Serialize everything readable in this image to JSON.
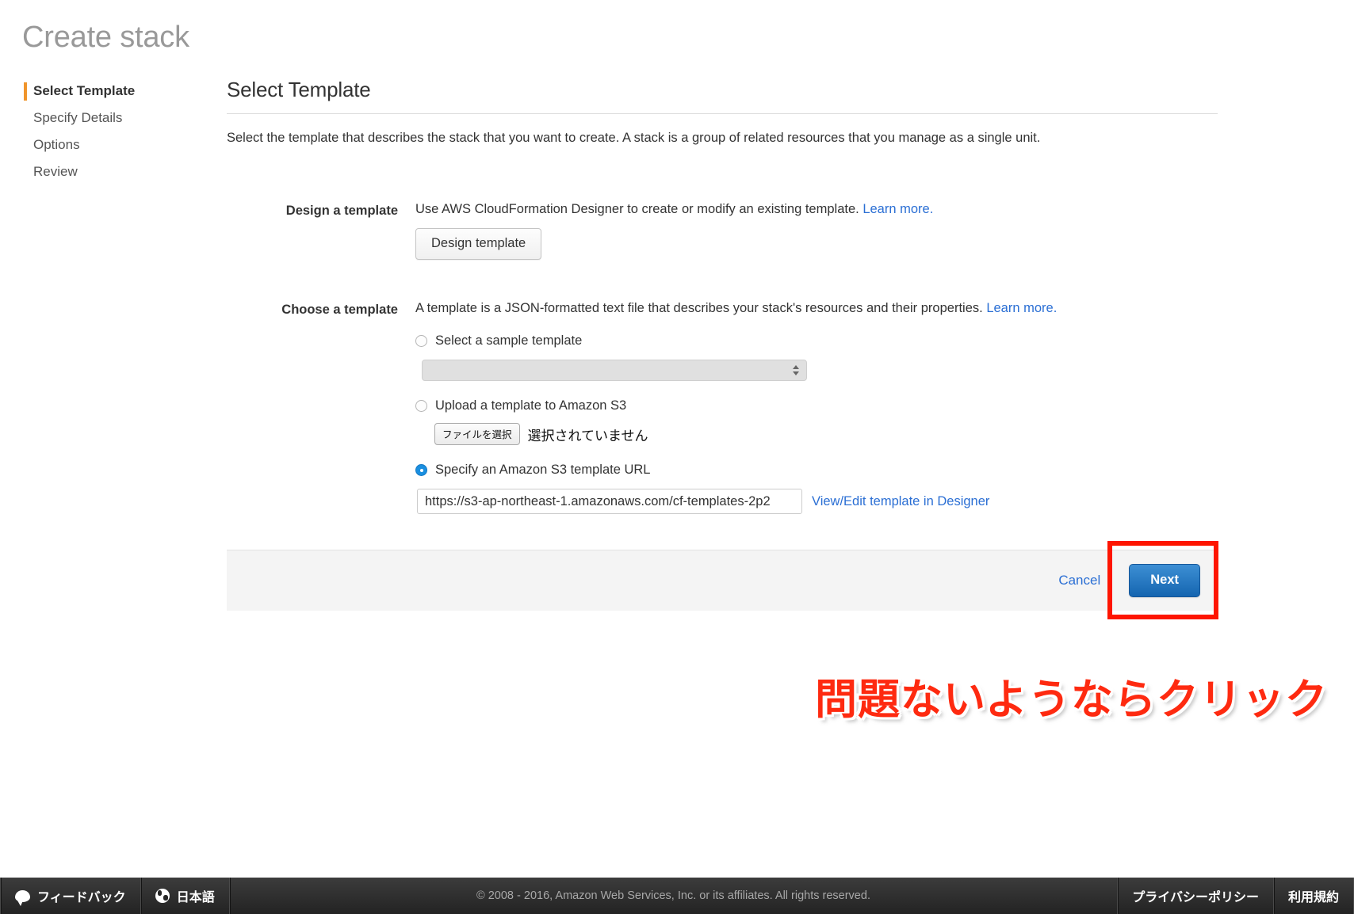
{
  "page_title": "Create stack",
  "sidebar": {
    "items": [
      {
        "label": "Select Template",
        "active": true
      },
      {
        "label": "Specify Details",
        "active": false
      },
      {
        "label": "Options",
        "active": false
      },
      {
        "label": "Review",
        "active": false
      }
    ]
  },
  "main": {
    "section_title": "Select Template",
    "intro": "Select the template that describes the stack that you want to create. A stack is a group of related resources that you manage as a single unit.",
    "design": {
      "label": "Design a template",
      "description": "Use AWS CloudFormation Designer to create or modify an existing template.",
      "learn_more": "Learn more.",
      "button_label": "Design template"
    },
    "choose": {
      "label": "Choose a template",
      "description": "A template is a JSON-formatted text file that describes your stack's resources and their properties.",
      "learn_more": "Learn more.",
      "option_sample": "Select a sample template",
      "sample_select_value": "",
      "option_upload": "Upload a template to Amazon S3",
      "file_button_label": "ファイルを選択",
      "file_status": "選択されていません",
      "option_url": "Specify an Amazon S3 template URL",
      "url_value": "https://s3-ap-northeast-1.amazonaws.com/cf-templates-2p2",
      "url_designer_link": "View/Edit template in Designer",
      "selected_option": "url"
    }
  },
  "actions": {
    "cancel_label": "Cancel",
    "next_label": "Next"
  },
  "annotation": {
    "caption": "問題ないようならクリック",
    "color": "#fe2a10",
    "box_color": "#fe1500"
  },
  "footer": {
    "feedback_label": "フィードバック",
    "language_label": "日本語",
    "copyright": "© 2008 - 2016, Amazon Web Services, Inc. or its affiliates. All rights reserved.",
    "privacy_label": "プライバシーポリシー",
    "terms_label": "利用規約"
  },
  "colors": {
    "accent_orange": "#f0952c",
    "link_blue": "#2b6fd4",
    "button_blue": "#1565b0"
  }
}
